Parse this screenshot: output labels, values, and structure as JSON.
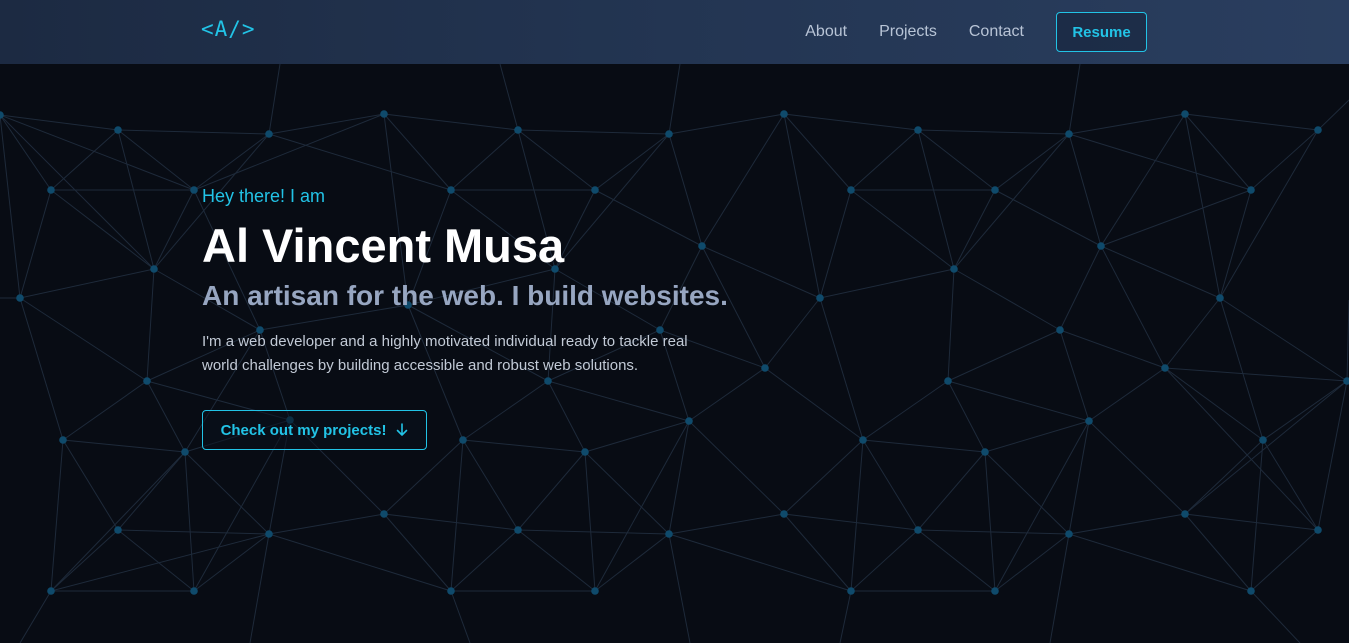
{
  "header": {
    "logo": "<A/>",
    "nav": [
      {
        "label": "About"
      },
      {
        "label": "Projects"
      },
      {
        "label": "Contact"
      }
    ],
    "resume_label": "Resume"
  },
  "hero": {
    "greeting": "Hey there! I am",
    "name": "Al Vincent Musa",
    "tagline": "An artisan for the web. I build websites.",
    "intro": "I'm a web developer and a highly motivated individual ready to tackle real world challenges by building accessible and robust web solutions.",
    "cta_label": "Check out my projects!",
    "cta_icon": "arrow-down-icon"
  },
  "colors": {
    "accent": "#22c3e6",
    "background": "#080c14",
    "nav_background": "#233552",
    "tagline": "#97a6c1",
    "network_node": "#0f4a6b",
    "network_line": "#1e2a3a"
  }
}
